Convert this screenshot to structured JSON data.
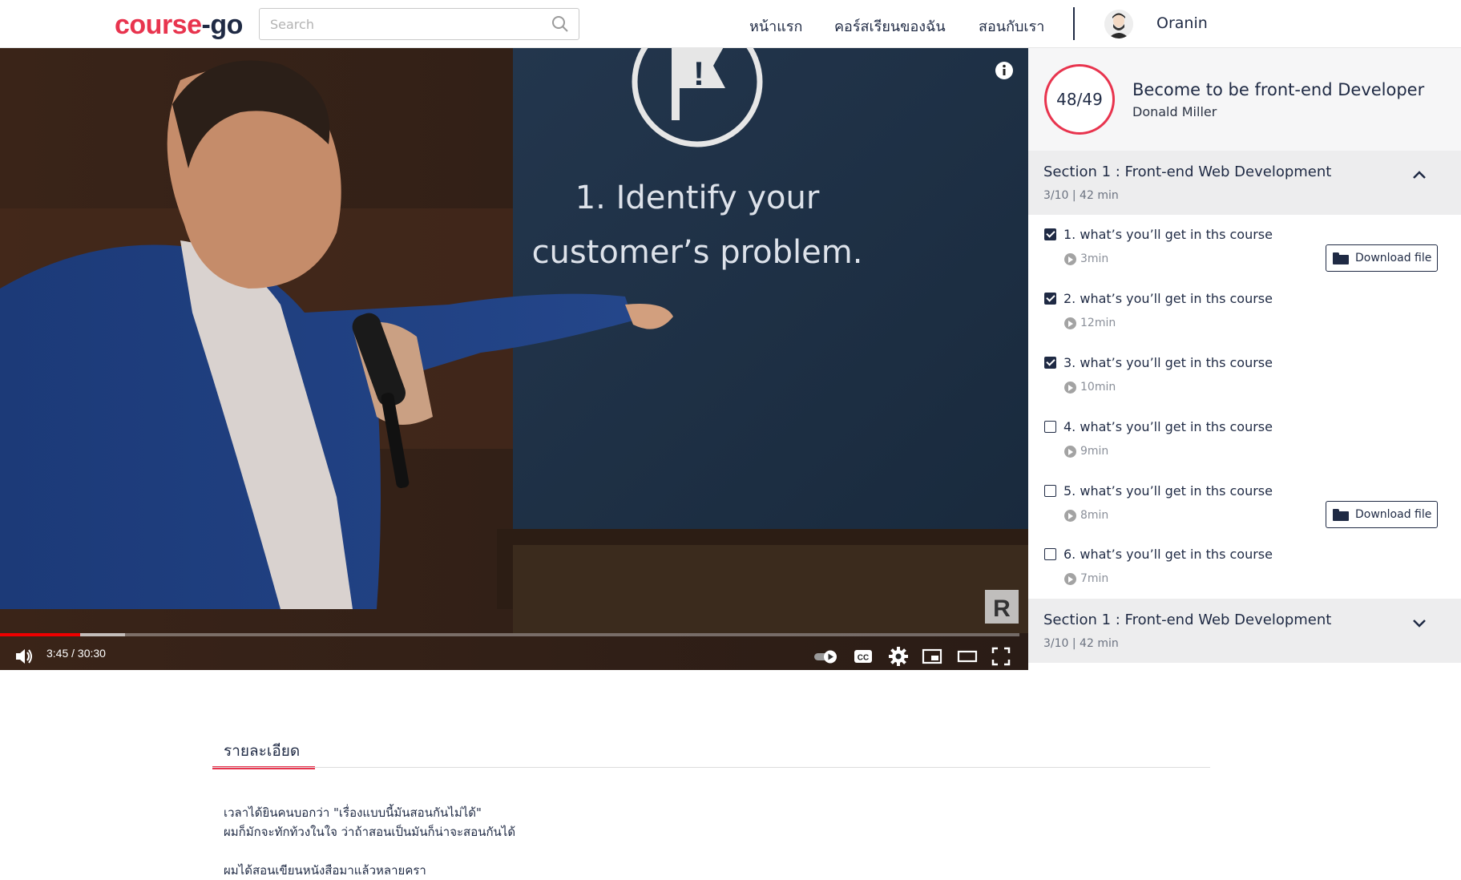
{
  "header": {
    "logo_part1": "course",
    "logo_part2": "-go",
    "search_placeholder": "Search",
    "nav": [
      "หน้าแรก",
      "คอร์สเรียนของฉัน",
      "สอนกับเรา"
    ],
    "username": "Oranin"
  },
  "video": {
    "slide_line1": "1. Identify your",
    "slide_line2": "customer’s problem.",
    "time": "3:45 / 30:30",
    "progress_fraction": 0.123,
    "buffered_fraction": 0.079,
    "watermark": "R"
  },
  "course": {
    "progress": "48/49",
    "title": "Become to be front-end Developer",
    "author": "Donald Miller"
  },
  "sections": [
    {
      "title": "Section 1 : Front-end Web Development",
      "meta": "3/10 | 42 min",
      "expanded": true
    },
    {
      "title": "Section 1 : Front-end Web Development",
      "meta": "3/10 | 42 min",
      "expanded": false
    }
  ],
  "lessons": [
    {
      "title": "1. what’s you’ll get in ths course",
      "duration": "3min",
      "checked": true,
      "download": "Download file"
    },
    {
      "title": "2. what’s you’ll get in ths course",
      "duration": "12min",
      "checked": true
    },
    {
      "title": "3. what’s you’ll get in ths course",
      "duration": "10min",
      "checked": true
    },
    {
      "title": "4. what’s you’ll get in ths course",
      "duration": "9min",
      "checked": false
    },
    {
      "title": "5. what’s you’ll get in ths course",
      "duration": "8min",
      "checked": false,
      "download": "Download file"
    },
    {
      "title": "6. what’s you’ll get in ths course",
      "duration": "7min",
      "checked": false
    }
  ],
  "details": {
    "tab_label": "รายละเอียด",
    "lines": [
      "เวลาได้ยินคนบอกว่า \"เรื่องแบบนี้มันสอนกันไม่ได้\"",
      "ผมก็มักจะทักท้วงในใจ ว่าถ้าสอนเป็นมันก็น่าจะสอนกันได้",
      "ผมได้สอนเขียนหนังสือมาแล้วหลายครา"
    ]
  },
  "colors": {
    "accent": "#e8344e",
    "navy": "#1f2a44",
    "video_bg": "#141a24"
  },
  "icons": [
    "search-icon",
    "info-icon",
    "volume-icon",
    "autoplay-toggle",
    "cc-icon",
    "settings-icon",
    "miniplayer-icon",
    "theater-icon",
    "fullscreen-icon",
    "chevron-up-icon",
    "chevron-down-icon",
    "folder-icon",
    "play-circle-icon"
  ]
}
